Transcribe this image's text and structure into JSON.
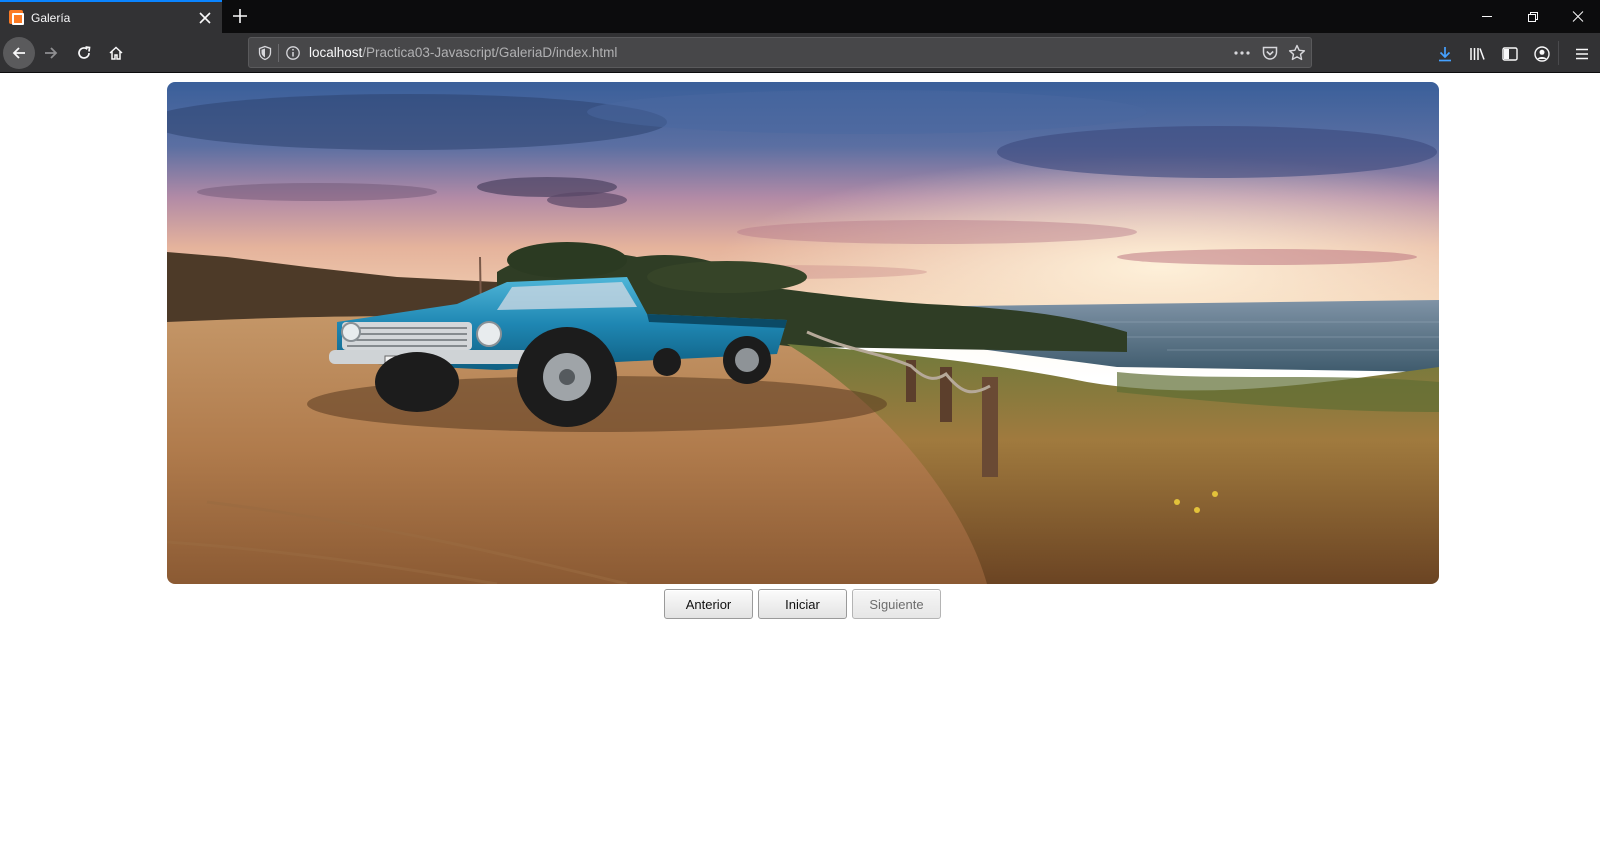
{
  "browser": {
    "tab": {
      "title": "Galería"
    },
    "url": {
      "host": "localhost",
      "path": "/Practica03-Javascript/GaleriaD/index.html"
    },
    "colors": {
      "accent": "#0a84ff",
      "chrome": "#323234",
      "tabstrip": "#0c0c0d"
    },
    "icons": [
      "xampp-favicon-icon",
      "close-icon",
      "plus-icon",
      "minimize-icon",
      "restore-icon",
      "window-close-icon",
      "back-icon",
      "forward-icon",
      "reload-icon",
      "home-icon",
      "shield-icon",
      "info-icon",
      "more-icon",
      "pocket-icon",
      "star-icon",
      "download-icon",
      "library-icon",
      "sidebar-icon",
      "account-icon",
      "menu-icon"
    ]
  },
  "gallery": {
    "image": "photo of a blue classic pickup truck on a dirt path by the sea at sunset"
  },
  "controls": {
    "prev_label": "Anterior",
    "start_label": "Iniciar",
    "next_label": "Siguiente"
  }
}
